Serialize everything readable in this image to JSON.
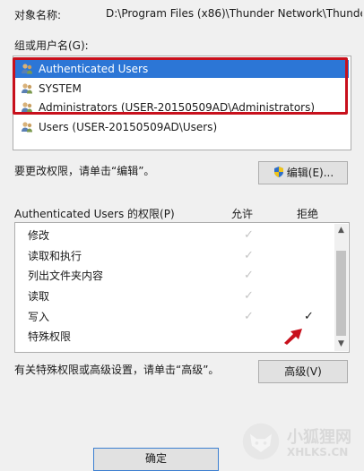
{
  "object_name": {
    "label": "对象名称:",
    "value": "D:\\Program Files (x86)\\Thunder Network\\Thunde"
  },
  "groups": {
    "label": "组或用户名(G):",
    "items": [
      {
        "name": "Authenticated Users",
        "selected": true
      },
      {
        "name": "SYSTEM",
        "selected": false
      },
      {
        "name": "Administrators (USER-20150509AD\\Administrators)",
        "selected": false
      },
      {
        "name": "Users (USER-20150509AD\\Users)",
        "selected": false
      }
    ]
  },
  "edit": {
    "hint": "要更改权限，请单击“编辑”。",
    "button_label": "编辑(E)..."
  },
  "permissions": {
    "title": "Authenticated Users 的权限(P)",
    "allow_header": "允许",
    "deny_header": "拒绝",
    "rows": [
      {
        "name": "修改",
        "allow": true,
        "deny": false
      },
      {
        "name": "读取和执行",
        "allow": true,
        "deny": false
      },
      {
        "name": "列出文件夹内容",
        "allow": true,
        "deny": false
      },
      {
        "name": "读取",
        "allow": true,
        "deny": false
      },
      {
        "name": "写入",
        "allow": true,
        "deny": true
      },
      {
        "name": "特殊权限",
        "allow": false,
        "deny": false
      }
    ]
  },
  "advanced": {
    "hint": "有关特殊权限或高级设置，请单击“高级”。",
    "button_label": "高级(V)"
  },
  "ok_button_label": "确定",
  "watermark": {
    "title": "小狐狸网",
    "url": "XHLKS.CN"
  },
  "colors": {
    "selection": "#2c76d6",
    "highlight": "#c8101c"
  },
  "icons": [
    "users-icon",
    "shield-icon",
    "red-arrow-icon",
    "fox-logo-icon"
  ]
}
